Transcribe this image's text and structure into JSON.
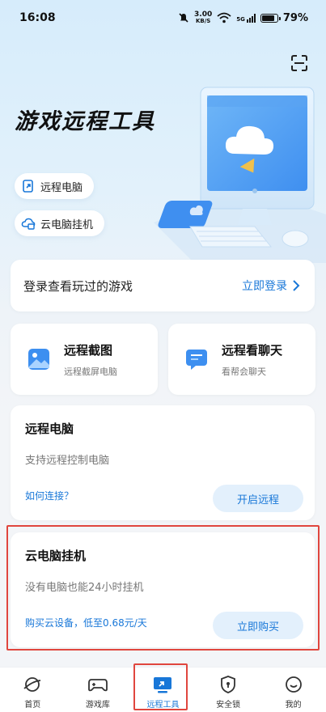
{
  "status_bar": {
    "time": "16:08",
    "net_speed_value": "3.00",
    "net_speed_unit": "KB/S",
    "battery": "79%",
    "network": "5G"
  },
  "hero": {
    "title": "游戏远程工具",
    "pills": [
      {
        "label": "远程电脑",
        "icon": "remote-pc-icon"
      },
      {
        "label": "云电脑挂机",
        "icon": "cloud-pc-icon"
      }
    ]
  },
  "login_card": {
    "text": "登录查看玩过的游戏",
    "link": "立即登录"
  },
  "features": [
    {
      "title": "远程截图",
      "subtitle": "远程截屏电脑",
      "icon": "image-icon"
    },
    {
      "title": "远程看聊天",
      "subtitle": "看帮会聊天",
      "icon": "chat-icon"
    }
  ],
  "remote_pc": {
    "title": "远程电脑",
    "subtitle": "支持远程控制电脑",
    "link": "如何连接？",
    "button": "开启远程"
  },
  "cloud_pc": {
    "title": "云电脑挂机",
    "subtitle": "没有电脑也能24小时挂机",
    "link": "购买云设备，低至0.68元/天",
    "button": "立即购买"
  },
  "tabs": [
    {
      "label": "首页",
      "icon": "planet-icon",
      "active": false
    },
    {
      "label": "游戏库",
      "icon": "gamepad-icon",
      "active": false
    },
    {
      "label": "远程工具",
      "icon": "monitor-icon",
      "active": true
    },
    {
      "label": "安全锁",
      "icon": "shield-icon",
      "active": false
    },
    {
      "label": "我的",
      "icon": "smile-icon",
      "active": false
    }
  ],
  "colors": {
    "accent": "#1877d8",
    "highlight_border": "#e0463e",
    "background": "#f3f5f8"
  }
}
